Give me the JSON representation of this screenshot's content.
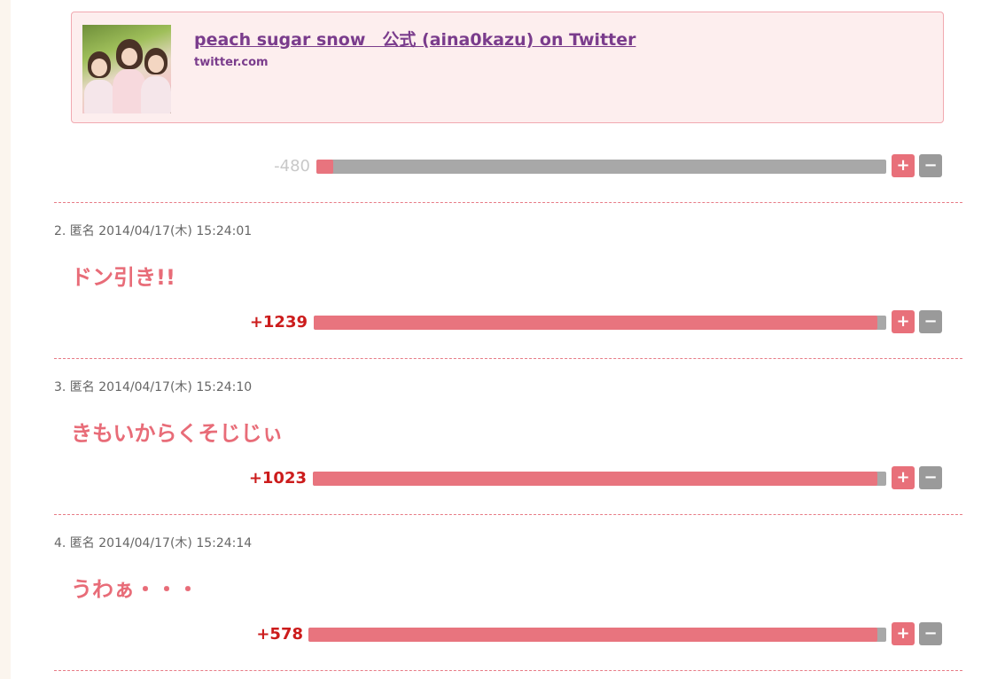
{
  "link_card": {
    "title": "peach sugar snow　公式 (aina0kazu) on Twitter",
    "domain": "twitter.com",
    "thumbnail": "photo-icon"
  },
  "first_vote": {
    "score": "-480",
    "positive_ratio": 0.03,
    "plus": "+",
    "minus": "−"
  },
  "comments": [
    {
      "meta": "2. 匿名 2014/04/17(木) 15:24:01",
      "body": "ドン引き!!",
      "score": "+1239",
      "positive_ratio": 0.985,
      "plus": "+",
      "minus": "−"
    },
    {
      "meta": "3. 匿名 2014/04/17(木) 15:24:10",
      "body": "きもいからくそじじぃ",
      "score": "+1023",
      "positive_ratio": 0.985,
      "plus": "+",
      "minus": "−"
    },
    {
      "meta": "4. 匿名 2014/04/17(木) 15:24:14",
      "body": "うわぁ・・・",
      "score": "+578",
      "positive_ratio": 0.985,
      "plus": "+",
      "minus": "−"
    }
  ],
  "colors": {
    "accent": "#e8747e",
    "link": "#7a3c8c",
    "score_positive": "#cc1c1c",
    "score_negative": "#c8c8c8"
  }
}
